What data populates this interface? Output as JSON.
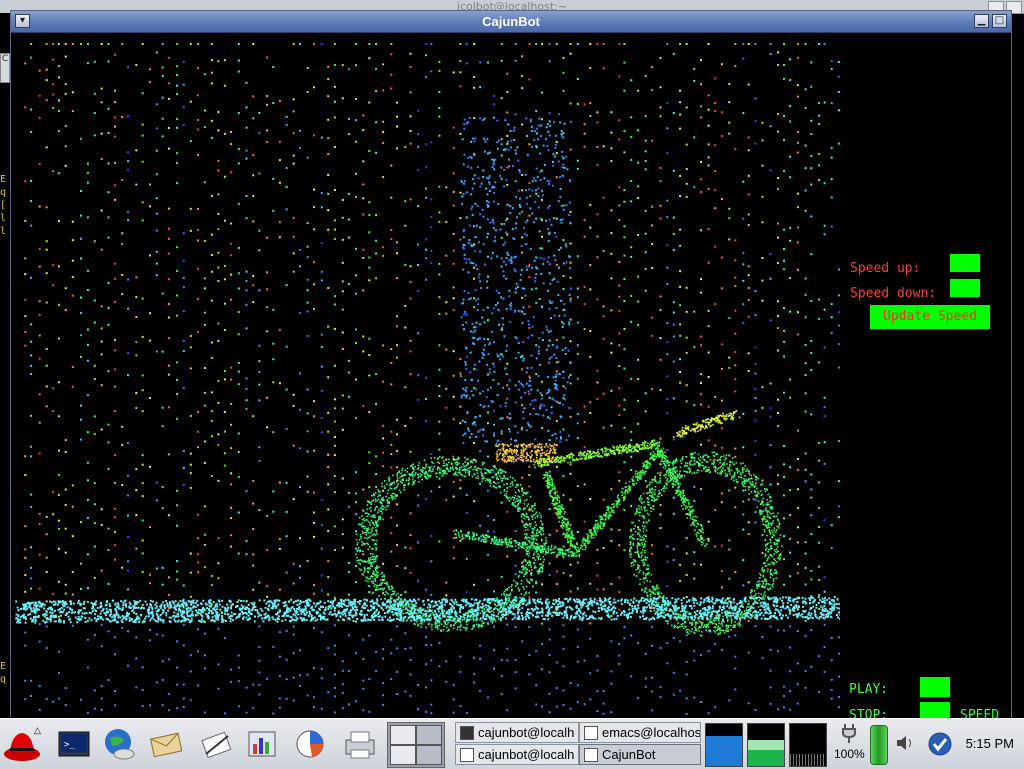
{
  "window": {
    "title": "CajunBot",
    "background_title": "jcolbot@localhost:~"
  },
  "left_strip": {
    "chars_top": [
      "E",
      "q",
      "[",
      "l",
      "l"
    ],
    "chars_bottom": [
      "E",
      "q"
    ],
    "tab_label": "C"
  },
  "panel": {
    "speed_up_label": "Speed up:",
    "speed_down_label": "Speed down:",
    "update_button": "Update Speed",
    "play_label": "PLAY:",
    "stop_label": "STOP:",
    "speed_label": "SPEED"
  },
  "taskbar": {
    "tasks": [
      {
        "label": "cajunbot@localh",
        "active": false
      },
      {
        "label": "emacs@localhos",
        "active": false
      },
      {
        "label": "cajunbot@localh",
        "active": false
      },
      {
        "label": "CajunBot",
        "active": true
      }
    ],
    "battery": "100%",
    "clock": "5:15 PM",
    "launchers": [
      "redhat-icon",
      "terminal-icon",
      "browser-icon",
      "mail-icon",
      "writer-icon",
      "impress-icon",
      "calc-icon",
      "print-icon"
    ]
  },
  "colors": {
    "panel_green": "#00ff00",
    "panel_red_text": "#ff3b3b",
    "ground_cyan": "#5fe6e6",
    "titlebar_blue": "#5d7bb8"
  }
}
